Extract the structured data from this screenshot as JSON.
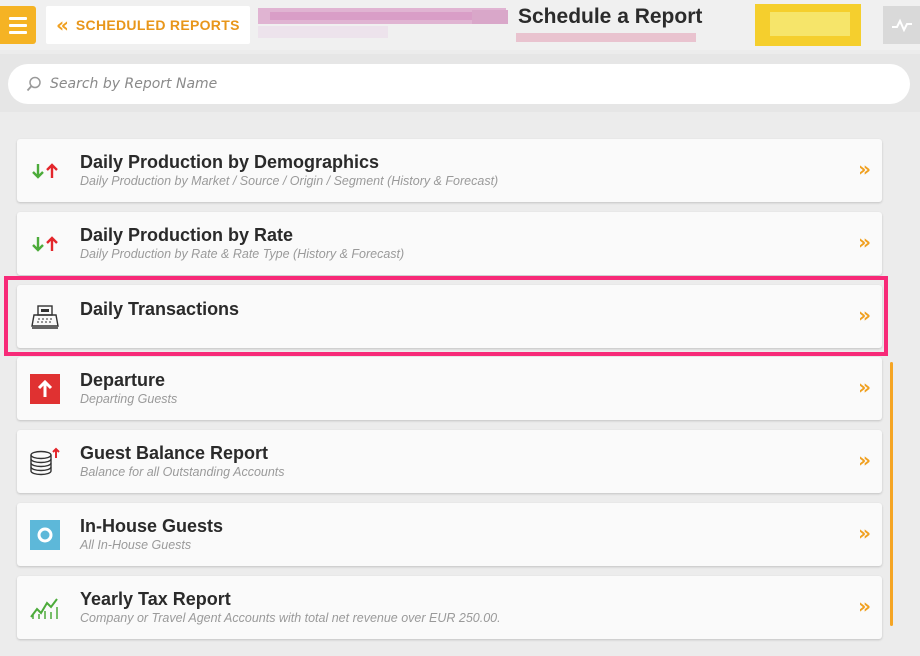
{
  "header": {
    "back_label": "SCHEDULED REPORTS",
    "title": "Schedule a Report"
  },
  "search": {
    "placeholder": "Search by Report Name"
  },
  "accent_color": "#f5a524",
  "highlight_color": "#f72a78",
  "reports": [
    {
      "title": "Daily Production by Demographics",
      "subtitle": "Daily Production by Market / Source / Origin / Segment (History & Forecast)",
      "icon": "up-down-arrows-icon",
      "selected": false
    },
    {
      "title": "Daily Production by Rate",
      "subtitle": "Daily Production by Rate & Rate Type (History & Forecast)",
      "icon": "up-down-arrows-icon",
      "selected": false
    },
    {
      "title": "Daily Transactions",
      "subtitle": "",
      "icon": "cash-register-icon",
      "selected": true
    },
    {
      "title": "Departure",
      "subtitle": "Departing Guests",
      "icon": "departure-arrow-icon",
      "selected": false
    },
    {
      "title": "Guest Balance Report",
      "subtitle": "Balance for all Outstanding Accounts",
      "icon": "coins-icon",
      "selected": false
    },
    {
      "title": "In-House Guests",
      "subtitle": "All In-House Guests",
      "icon": "in-house-icon",
      "selected": false
    },
    {
      "title": "Yearly Tax Report",
      "subtitle": "Company or Travel Agent Accounts with total net revenue over EUR 250.00.",
      "icon": "trend-chart-icon",
      "selected": false
    }
  ]
}
